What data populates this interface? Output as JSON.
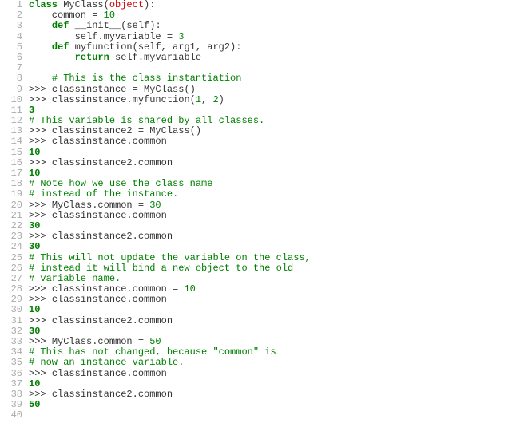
{
  "code": {
    "lines": [
      {
        "n": "1",
        "segments": [
          {
            "c": "kw",
            "t": "class"
          },
          {
            "c": "name",
            "t": " MyClass("
          },
          {
            "c": "base",
            "t": "object"
          },
          {
            "c": "name",
            "t": "):"
          }
        ]
      },
      {
        "n": "2",
        "segments": [
          {
            "c": "name",
            "t": "    common = "
          },
          {
            "c": "numlit",
            "t": "10"
          }
        ]
      },
      {
        "n": "3",
        "segments": [
          {
            "c": "name",
            "t": "    "
          },
          {
            "c": "kw",
            "t": "def"
          },
          {
            "c": "name",
            "t": " __init__(self):"
          }
        ]
      },
      {
        "n": "4",
        "segments": [
          {
            "c": "name",
            "t": "        self.myvariable = "
          },
          {
            "c": "numlit",
            "t": "3"
          }
        ]
      },
      {
        "n": "5",
        "segments": [
          {
            "c": "name",
            "t": "    "
          },
          {
            "c": "kw",
            "t": "def"
          },
          {
            "c": "name",
            "t": " myfunction(self, arg1, arg2):"
          }
        ]
      },
      {
        "n": "6",
        "segments": [
          {
            "c": "name",
            "t": "        "
          },
          {
            "c": "kw",
            "t": "return"
          },
          {
            "c": "name",
            "t": " self.myvariable"
          }
        ]
      },
      {
        "n": "7",
        "segments": [
          {
            "c": "name",
            "t": ""
          }
        ]
      },
      {
        "n": "8",
        "segments": [
          {
            "c": "name",
            "t": "    "
          },
          {
            "c": "cmt",
            "t": "# This is the class instantiation"
          }
        ]
      },
      {
        "n": "9",
        "segments": [
          {
            "c": "prompt",
            "t": ">>> "
          },
          {
            "c": "name",
            "t": "classinstance = MyClass()"
          }
        ]
      },
      {
        "n": "10",
        "segments": [
          {
            "c": "prompt",
            "t": ">>> "
          },
          {
            "c": "name",
            "t": "classinstance.myfunction("
          },
          {
            "c": "numlit",
            "t": "1"
          },
          {
            "c": "name",
            "t": ", "
          },
          {
            "c": "numlit",
            "t": "2"
          },
          {
            "c": "name",
            "t": ")"
          }
        ]
      },
      {
        "n": "11",
        "segments": [
          {
            "c": "outnum",
            "t": "3"
          }
        ]
      },
      {
        "n": "12",
        "segments": [
          {
            "c": "cmt",
            "t": "# This variable is shared by all classes."
          }
        ]
      },
      {
        "n": "13",
        "segments": [
          {
            "c": "prompt",
            "t": ">>> "
          },
          {
            "c": "name",
            "t": "classinstance2 = MyClass()"
          }
        ]
      },
      {
        "n": "14",
        "segments": [
          {
            "c": "prompt",
            "t": ">>> "
          },
          {
            "c": "name",
            "t": "classinstance.common"
          }
        ]
      },
      {
        "n": "15",
        "segments": [
          {
            "c": "outnum",
            "t": "10"
          }
        ]
      },
      {
        "n": "16",
        "segments": [
          {
            "c": "prompt",
            "t": ">>> "
          },
          {
            "c": "name",
            "t": "classinstance2.common"
          }
        ]
      },
      {
        "n": "17",
        "segments": [
          {
            "c": "outnum",
            "t": "10"
          }
        ]
      },
      {
        "n": "18",
        "segments": [
          {
            "c": "cmt",
            "t": "# Note how we use the class name"
          }
        ]
      },
      {
        "n": "19",
        "segments": [
          {
            "c": "cmt",
            "t": "# instead of the instance."
          }
        ]
      },
      {
        "n": "20",
        "segments": [
          {
            "c": "prompt",
            "t": ">>> "
          },
          {
            "c": "name",
            "t": "MyClass.common = "
          },
          {
            "c": "numlit",
            "t": "30"
          }
        ]
      },
      {
        "n": "21",
        "segments": [
          {
            "c": "prompt",
            "t": ">>> "
          },
          {
            "c": "name",
            "t": "classinstance.common"
          }
        ]
      },
      {
        "n": "22",
        "segments": [
          {
            "c": "outnum",
            "t": "30"
          }
        ]
      },
      {
        "n": "23",
        "segments": [
          {
            "c": "prompt",
            "t": ">>> "
          },
          {
            "c": "name",
            "t": "classinstance2.common"
          }
        ]
      },
      {
        "n": "24",
        "segments": [
          {
            "c": "outnum",
            "t": "30"
          }
        ]
      },
      {
        "n": "25",
        "segments": [
          {
            "c": "cmt",
            "t": "# This will not update the variable on the class,"
          }
        ]
      },
      {
        "n": "26",
        "segments": [
          {
            "c": "cmt",
            "t": "# instead it will bind a new object to the old"
          }
        ]
      },
      {
        "n": "27",
        "segments": [
          {
            "c": "cmt",
            "t": "# variable name."
          }
        ]
      },
      {
        "n": "28",
        "segments": [
          {
            "c": "prompt",
            "t": ">>> "
          },
          {
            "c": "name",
            "t": "classinstance.common = "
          },
          {
            "c": "numlit",
            "t": "10"
          }
        ]
      },
      {
        "n": "29",
        "segments": [
          {
            "c": "prompt",
            "t": ">>> "
          },
          {
            "c": "name",
            "t": "classinstance.common"
          }
        ]
      },
      {
        "n": "30",
        "segments": [
          {
            "c": "outnum",
            "t": "10"
          }
        ]
      },
      {
        "n": "31",
        "segments": [
          {
            "c": "prompt",
            "t": ">>> "
          },
          {
            "c": "name",
            "t": "classinstance2.common"
          }
        ]
      },
      {
        "n": "32",
        "segments": [
          {
            "c": "outnum",
            "t": "30"
          }
        ]
      },
      {
        "n": "33",
        "segments": [
          {
            "c": "prompt",
            "t": ">>> "
          },
          {
            "c": "name",
            "t": "MyClass.common = "
          },
          {
            "c": "numlit",
            "t": "50"
          }
        ]
      },
      {
        "n": "34",
        "segments": [
          {
            "c": "cmt",
            "t": "# This has not changed, because \"common\" is"
          }
        ]
      },
      {
        "n": "35",
        "segments": [
          {
            "c": "cmt",
            "t": "# now an instance variable."
          }
        ]
      },
      {
        "n": "36",
        "segments": [
          {
            "c": "prompt",
            "t": ">>> "
          },
          {
            "c": "name",
            "t": "classinstance.common"
          }
        ]
      },
      {
        "n": "37",
        "segments": [
          {
            "c": "outnum",
            "t": "10"
          }
        ]
      },
      {
        "n": "38",
        "segments": [
          {
            "c": "prompt",
            "t": ">>> "
          },
          {
            "c": "name",
            "t": "classinstance2.common"
          }
        ]
      },
      {
        "n": "39",
        "segments": [
          {
            "c": "outnum",
            "t": "50"
          }
        ]
      },
      {
        "n": "40",
        "segments": [
          {
            "c": "name",
            "t": ""
          }
        ]
      }
    ]
  }
}
